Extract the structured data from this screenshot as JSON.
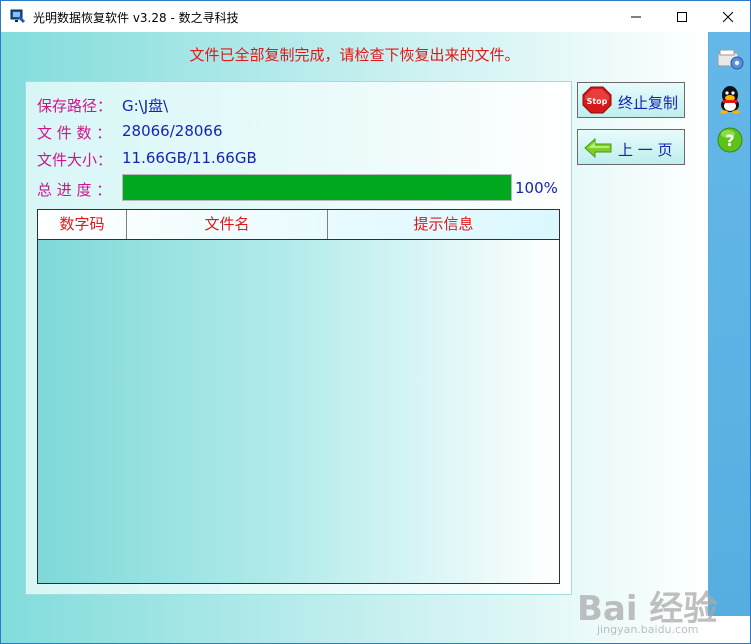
{
  "window": {
    "title": "光明数据恢复软件 v3.28 - 数之寻科技"
  },
  "status": {
    "message": "文件已全部复制完成，请检查下恢复出来的文件。"
  },
  "info": {
    "save_path_label": "保存路径：",
    "save_path_value": "G:\\J盘\\",
    "file_count_label": "文 件 数 ：",
    "file_count_value": "28066/28066",
    "file_size_label": "文件大小：",
    "file_size_value": "11.66GB/11.66GB",
    "progress_label": "总 进 度 ：",
    "progress_value": 1.0,
    "progress_text": "100%"
  },
  "table": {
    "columns": [
      "数字码",
      "文件名",
      "提示信息"
    ],
    "rows": []
  },
  "buttons": {
    "stop_label": "终止复制",
    "stop_icon_text": "Stop",
    "prev_label": "上 一 页"
  },
  "sidebar": {
    "icons": [
      "settings-icon",
      "qq-icon",
      "help-icon"
    ]
  },
  "watermark": {
    "text": "Bai 经验",
    "subtext": "jingyan.baidu.com"
  },
  "colors": {
    "progress_fill": "#00a820",
    "label": "#d0148c",
    "value": "#1424b4",
    "header_text": "#e01818"
  }
}
